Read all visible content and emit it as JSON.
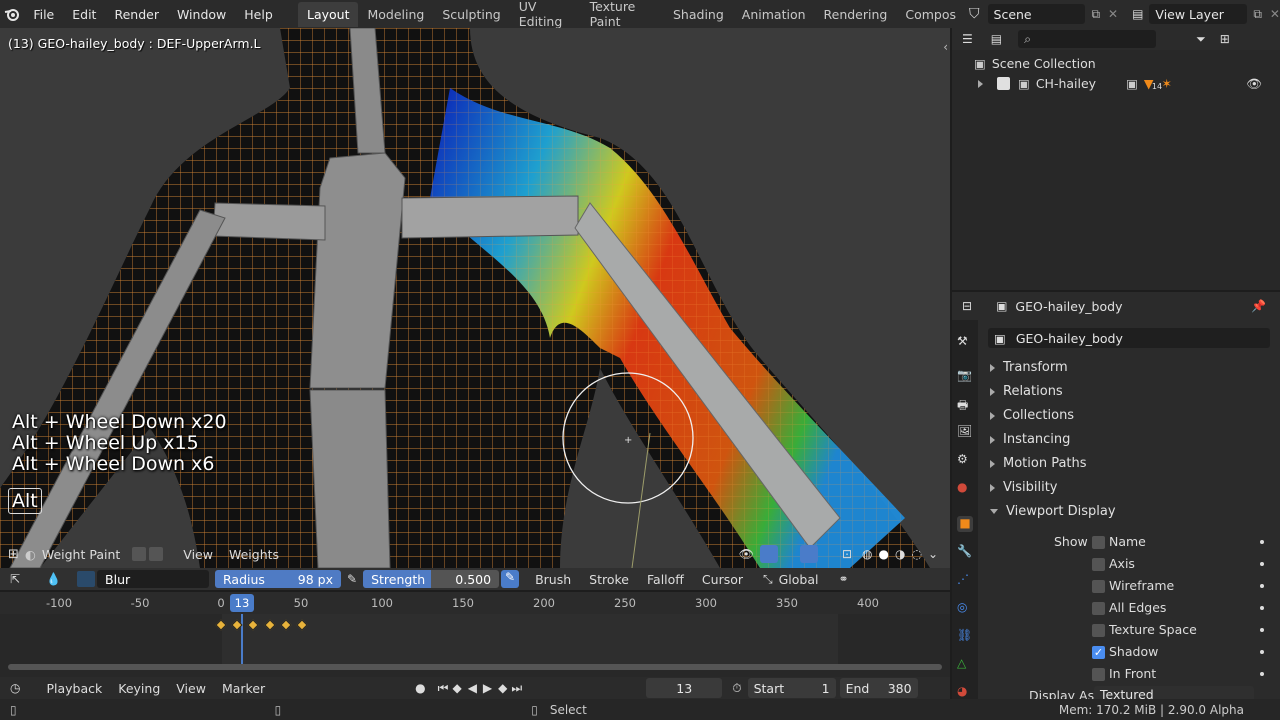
{
  "menus": [
    "File",
    "Edit",
    "Render",
    "Window",
    "Help"
  ],
  "workspaces": [
    "Layout",
    "Modeling",
    "Sculpting",
    "UV Editing",
    "Texture Paint",
    "Shading",
    "Animation",
    "Rendering",
    "Compos"
  ],
  "active_workspace": "Layout",
  "scene_name": "Scene",
  "view_layer_name": "View Layer",
  "viewport": {
    "object_info": "(13) GEO-hailey_body : DEF-UpperArm.L",
    "key_overlay": [
      "Alt + Wheel Down x20",
      "Alt + Wheel Up x15",
      "Alt + Wheel Down x6"
    ],
    "key_held": "Alt",
    "mode": "Weight Paint",
    "view_menu": "View",
    "weights_menu": "Weights"
  },
  "tool_settings": {
    "brush_name": "Blur",
    "radius_label": "Radius",
    "radius_value": "98 px",
    "strength_label": "Strength",
    "strength_value": "0.500",
    "strength_fraction": 0.5,
    "brush_menu": "Brush",
    "stroke_menu": "Stroke",
    "falloff_menu": "Falloff",
    "cursor_menu": "Cursor",
    "orientation": "Global"
  },
  "timeline": {
    "ticks": [
      "-100",
      "-50",
      "0",
      "50",
      "100",
      "150",
      "200",
      "250",
      "300",
      "350",
      "400"
    ],
    "current_frame": "13",
    "keyframe_frames": [
      0,
      10,
      20,
      30,
      40,
      50
    ],
    "playback_menu": "Playback",
    "keying_menu": "Keying",
    "view_menu": "View",
    "marker_menu": "Marker",
    "frame_field": "13",
    "start_label": "Start",
    "start_value": "1",
    "end_label": "End",
    "end_value": "380"
  },
  "status": {
    "select_label": "Select",
    "memory": "Mem: 170.2 MiB | 2.90.0 Alpha"
  },
  "outliner": {
    "search_placeholder": "",
    "scene_collection": "Scene Collection",
    "collection_item": "CH-hailey",
    "collection_badge": "14"
  },
  "properties": {
    "object_name": "GEO-hailey_body",
    "data_name": "GEO-hailey_body",
    "sections": [
      "Transform",
      "Relations",
      "Collections",
      "Instancing",
      "Motion Paths",
      "Visibility",
      "Viewport Display"
    ],
    "show_label": "Show",
    "show_options": [
      {
        "label": "Name",
        "checked": false
      },
      {
        "label": "Axis",
        "checked": false
      },
      {
        "label": "Wireframe",
        "checked": false
      },
      {
        "label": "All Edges",
        "checked": false
      },
      {
        "label": "Texture Space",
        "checked": false
      },
      {
        "label": "Shadow",
        "checked": true
      },
      {
        "label": "In Front",
        "checked": false
      }
    ],
    "display_as_label": "Display As",
    "display_as_value": "Textured"
  },
  "colors": {
    "accent_blue": "#4a8df0",
    "keyframe": "#e8b33b",
    "playhead": "#4a7cc9",
    "wire_orange": "#e8913a",
    "active_object_orange": "#f08a1a"
  }
}
